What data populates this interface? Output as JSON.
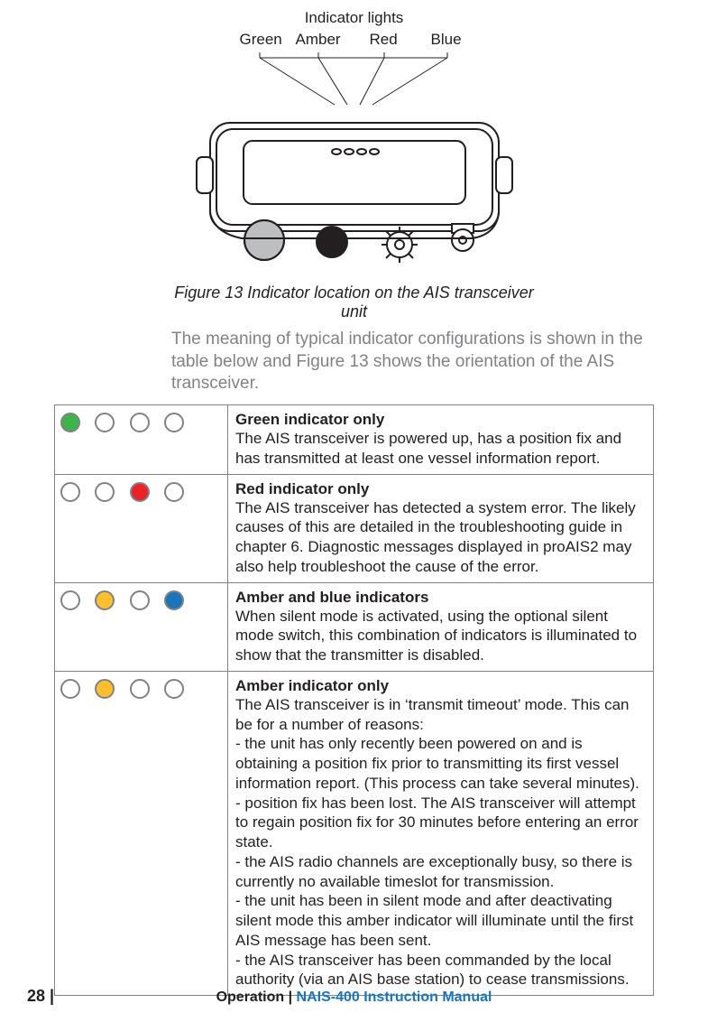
{
  "diagram": {
    "title": "Indicator lights",
    "labels": {
      "green": "Green",
      "amber": "Amber",
      "red": "Red",
      "blue": "Blue"
    },
    "caption": "Figure 13 Indicator location on the AIS transceiver unit"
  },
  "intro": "The meaning of typical indicator configurations is shown in the table below and Figure 13 shows the orientation of the AIS trans­ceiver.",
  "rows": [
    {
      "title": "Green indicator only",
      "body": "The AIS transceiver is powered up, has a position fix and has transmitted at least one vessel information report."
    },
    {
      "title": "Red indicator only",
      "body": "The AIS transceiver has detected a system error. The likely causes of this are detailed in the troubleshooting guide in chapter 6. Diagnostic messages displayed in proAIS2 may also help troubleshoot the cause of the error."
    },
    {
      "title": "Amber and blue indicators",
      "body": "When silent mode is activated, using the optional silent mode switch, this combination of indicators is illuminated to show that the transmitter is disabled."
    },
    {
      "title": "Amber indicator only",
      "body": "The AIS transceiver is in ‘transmit timeout’ mode. This can be for a number of reasons:",
      "reasons": [
        "- the unit has only recently been powered on and is obtaining a position fix prior to transmitting its first vessel information report. (This process can take several minutes).",
        "- position fix has been lost. The AIS transceiver will attempt to regain position fix for 30 minutes before entering an error state.",
        "- the AIS radio channels are exceptionally busy, so there is currently no available timeslot for transmission.",
        "- the unit has been in silent mode and after deactivating silent mode this amber indicator will illuminate until the first AIS message has been sent.",
        "- the AIS transceiver has been commanded by the local authority (via an AIS base station) to cease transmissions."
      ]
    }
  ],
  "footer": {
    "page": "28 |",
    "operation": "Operation | ",
    "manual": "NAIS-400 Instruction Manual"
  }
}
